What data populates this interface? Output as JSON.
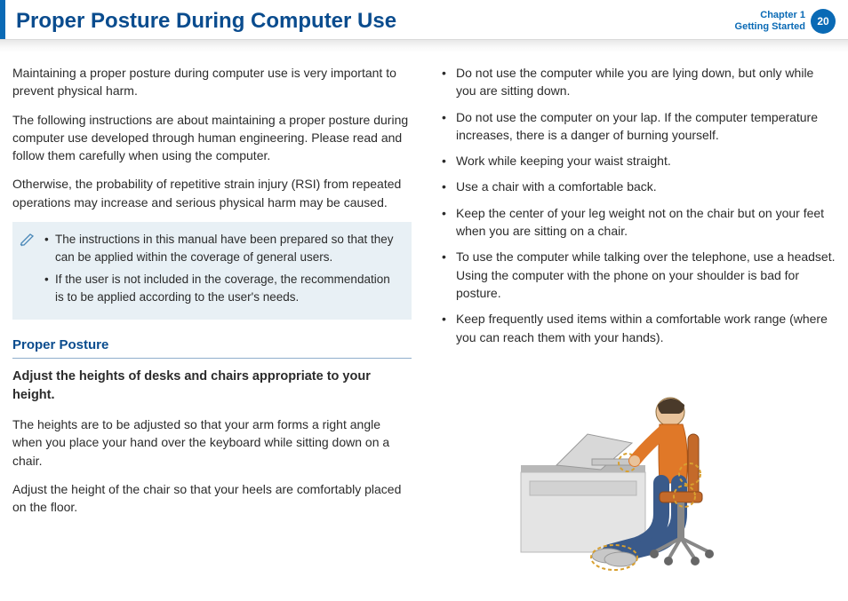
{
  "header": {
    "title": "Proper Posture During Computer Use",
    "chapter_line1": "Chapter 1",
    "chapter_line2": "Getting Started",
    "page": "20"
  },
  "left": {
    "p1": "Maintaining a proper posture during computer use is very important to prevent physical harm.",
    "p2": "The following instructions are about maintaining a proper posture during computer use developed through human engineering. Please read and follow them carefully when using the computer.",
    "p3": "Otherwise, the probability of repetitive strain injury (RSI) from repeated operations may increase and serious physical harm may be caused.",
    "note": {
      "items": [
        "The instructions in this manual have been prepared so that they can be applied within the coverage of general users.",
        "If the user is not included in the coverage, the recommendation is to be applied according to the user's needs."
      ]
    },
    "section_heading": "Proper Posture",
    "sub_heading": "Adjust the heights of desks and chairs appropriate to your height.",
    "p4": "The heights are to be adjusted so that your arm forms a right angle when you place your hand over the keyboard while sitting down on a chair.",
    "p5": "Adjust the height of the chair so that your heels are comfortably placed on the floor."
  },
  "right": {
    "items": [
      "Do not use the computer while you are lying down, but only while you are sitting down.",
      "Do not use the computer on your lap. If the computer temperature increases, there is a danger of burning yourself.",
      "Work while keeping your waist straight.",
      "Use a chair with a comfortable back.",
      "Keep the center of your leg weight not on the chair but on your feet when you are sitting on a chair.",
      "To use the computer while talking over the telephone, use a headset. Using the computer with the phone on your shoulder is bad for posture.",
      "Keep frequently used items within a comfortable work range (where you can reach them with your hands)."
    ]
  }
}
